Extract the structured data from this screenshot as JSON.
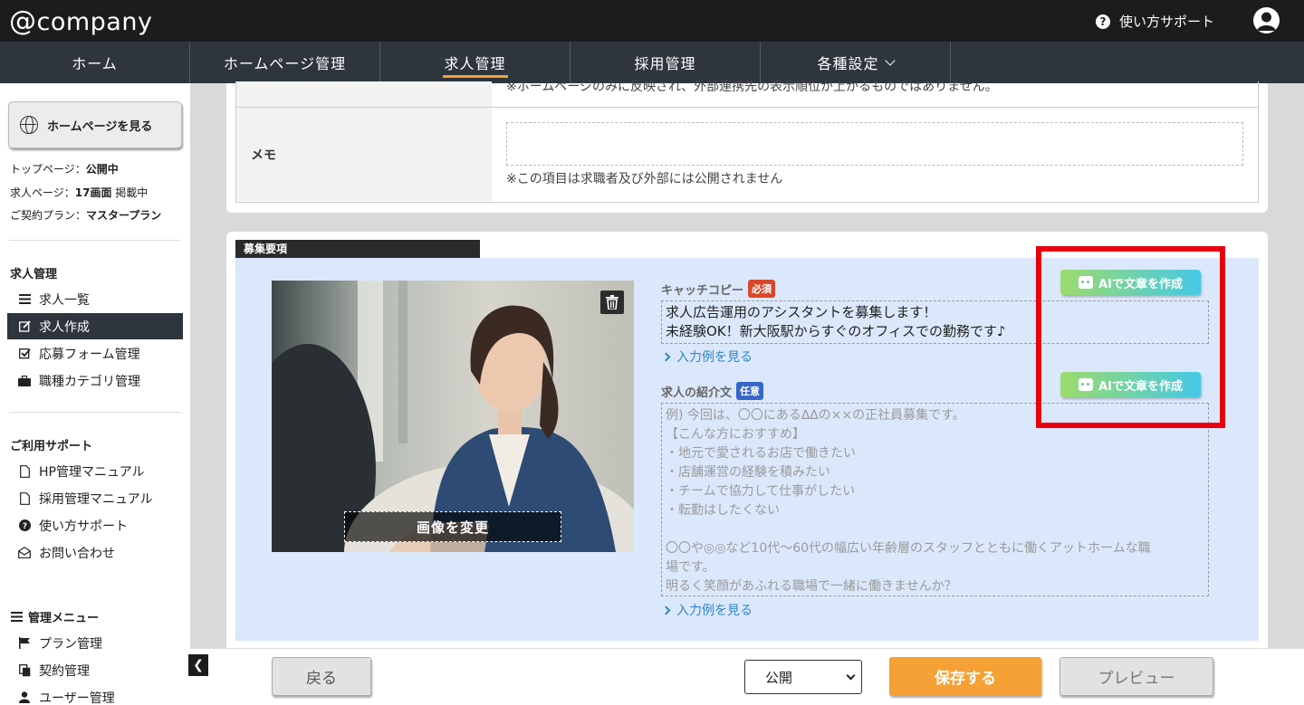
{
  "header": {
    "logo": "company",
    "help_label": "使い方サポート"
  },
  "nav": {
    "items": [
      {
        "label": "ホーム"
      },
      {
        "label": "ホームページ管理"
      },
      {
        "label": "求人管理"
      },
      {
        "label": "採用管理"
      },
      {
        "label": "各種設定"
      }
    ]
  },
  "sidebar": {
    "view_hp_button": "ホームページを見る",
    "status": {
      "top_label": "トップページ：",
      "top_value": "公開中",
      "job_label": "求人ページ：",
      "job_count": "17画面",
      "job_state": " 掲載中",
      "plan_label": "ご契約プラン：",
      "plan_value": "マスタープラン"
    },
    "job_section_title": "求人管理",
    "job_items": [
      {
        "label": "求人一覧"
      },
      {
        "label": "求人作成"
      },
      {
        "label": "応募フォーム管理"
      },
      {
        "label": "職種カテゴリ管理"
      }
    ],
    "support_section_title": "ご利用サポート",
    "support_items": [
      {
        "label": "HP管理マニュアル"
      },
      {
        "label": "採用管理マニュアル"
      },
      {
        "label": "使い方サポート"
      },
      {
        "label": "お問い合わせ"
      }
    ],
    "admin_section_title": "管理メニュー",
    "admin_items": [
      {
        "label": "プラン管理"
      },
      {
        "label": "契約管理"
      },
      {
        "label": "ユーザー管理"
      }
    ]
  },
  "upper_card": {
    "top_note": "※ホームページのみに反映され、外部連携先の表示順位が上がるものではありません。",
    "memo_label": "メモ",
    "memo_value": "",
    "memo_note": "※この項目は求職者及び外部には公開されません"
  },
  "recruit_section": {
    "tab_label": "募集要項",
    "change_image_label": "画像を変更",
    "catch_label": "キャッチコピー",
    "required_badge": "必須",
    "catch_line1": "求人広告運用のアシスタントを募集します！",
    "catch_line2": "未経験OK！新大阪駅からすぐのオフィスでの勤務です♪",
    "example_link": "入力例を見る",
    "intro_label": "求人の紹介文",
    "optional_badge": "任意",
    "intro_placeholder": "例) 今回は、〇〇にある∆∆の××の正社員募集です。\n【こんな方におすすめ】\n・地元で愛されるお店で働きたい\n・店舗運営の経験を積みたい\n・チームで協力して仕事がしたい\n・転勤はしたくない\n\n〇〇や◎◎など10代〜60代の幅広い年齢層のスタッフとともに働くアットホームな職\n場です。\n明るく笑顔があふれる職場で一緒に働きませんか？",
    "ai_button": "AIで文章を作成"
  },
  "footer": {
    "back_label": "戻る",
    "publish_selected": "公開",
    "save_label": "保存する",
    "preview_label": "プレビュー"
  },
  "colors": {
    "accent": "#f5a135",
    "nav_bg": "#2e353c",
    "highlight": "#e8000e",
    "section_bg": "#dbe8fb"
  }
}
